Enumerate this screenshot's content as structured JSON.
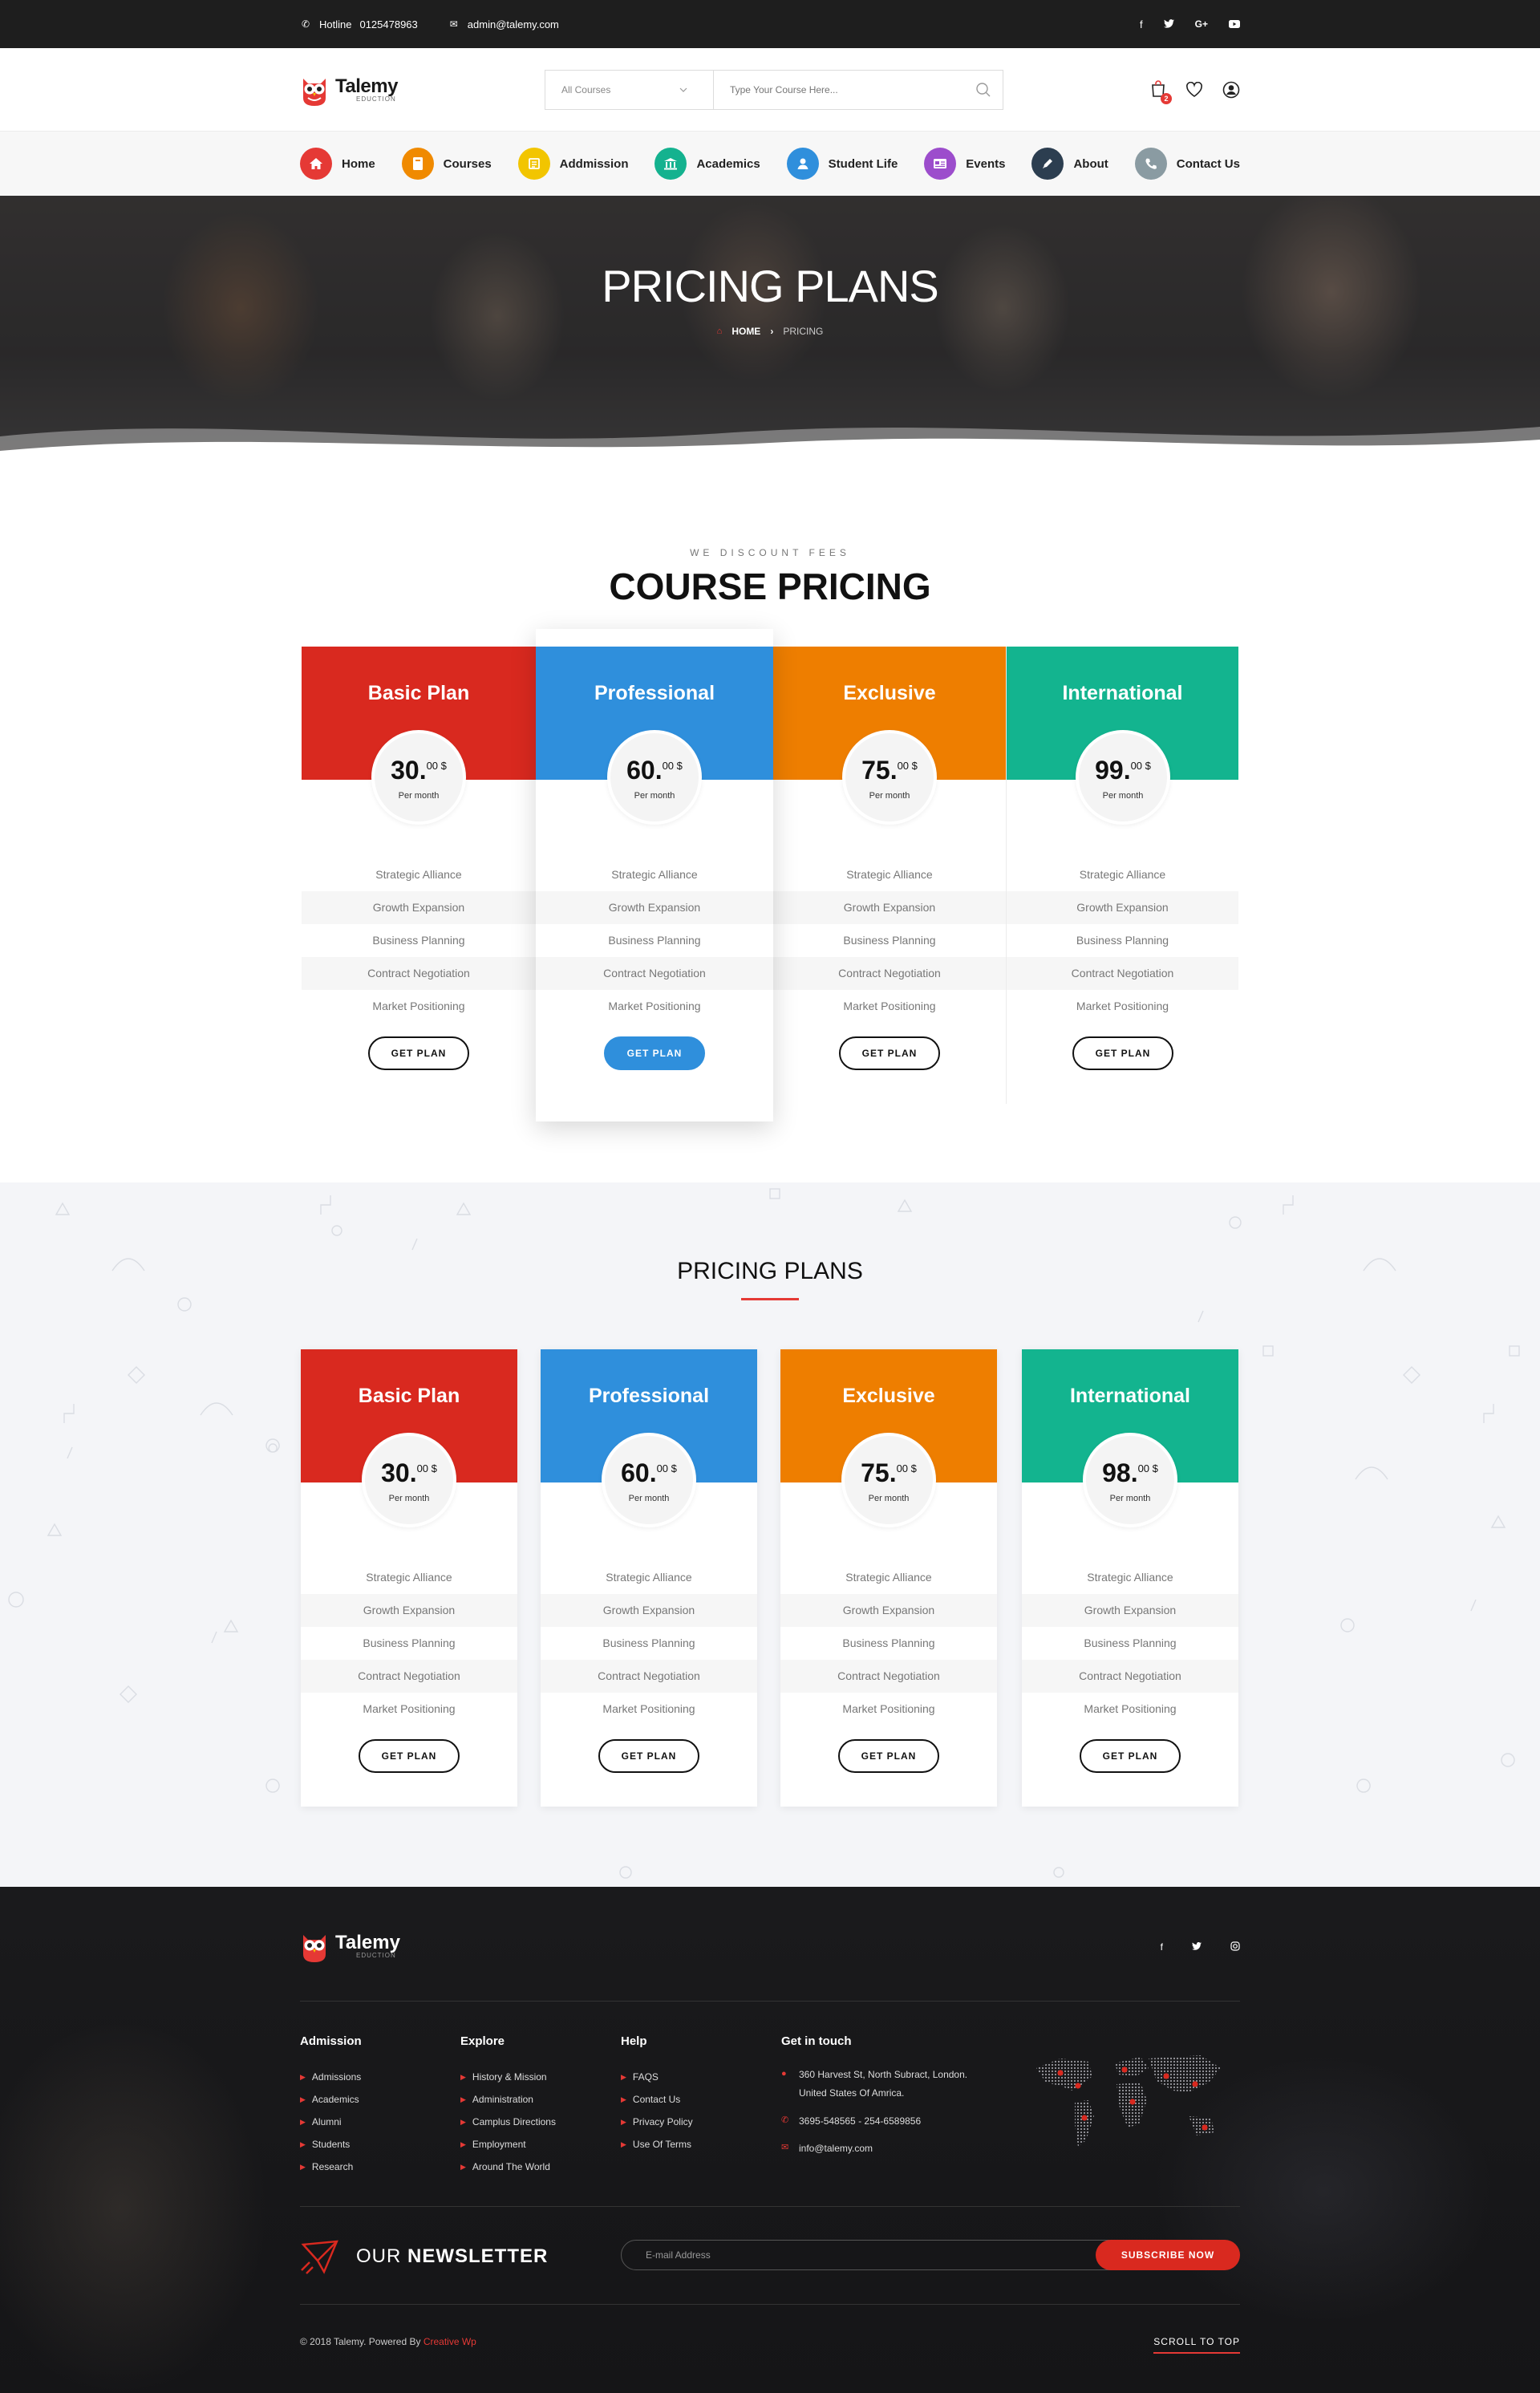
{
  "topbar": {
    "hotline_label": "Hotline",
    "hotline_number": "0125478963",
    "email": "admin@talemy.com",
    "socials": [
      "f",
      "t",
      "G+",
      "yt"
    ]
  },
  "header": {
    "brand": "Talemy",
    "tagline": "EDUCTION",
    "search_category": "All Courses",
    "search_placeholder": "Type Your Course Here...",
    "cart_count": "2"
  },
  "nav": [
    {
      "label": "Home",
      "icon": "home-icon",
      "color": "#e53935"
    },
    {
      "label": "Courses",
      "icon": "book-icon",
      "color": "#f08a00"
    },
    {
      "label": "Addmission",
      "icon": "document-icon",
      "color": "#f2c500"
    },
    {
      "label": "Academics",
      "icon": "bank-icon",
      "color": "#14b28f"
    },
    {
      "label": "Student Life",
      "icon": "user-icon",
      "color": "#2f8fdc"
    },
    {
      "label": "Events",
      "icon": "calendar-icon",
      "color": "#9c4dcc"
    },
    {
      "label": "About",
      "icon": "pen-icon",
      "color": "#2c3e50"
    },
    {
      "label": "Contact Us",
      "icon": "phone-icon",
      "color": "#8a9ba2"
    }
  ],
  "hero": {
    "title": "PRICING PLANS",
    "crumb_home": "HOME",
    "crumb_sep": "›",
    "crumb_current": "PRICING"
  },
  "section1": {
    "eyebrow": "WE DISCOUNT FEES",
    "title": "COURSE PRICING",
    "plans": [
      {
        "name": "Basic Plan",
        "price": "30.",
        "cents": "00 $",
        "period": "Per month",
        "color": "#d9291f",
        "button": "GET PLAN"
      },
      {
        "name": "Professional",
        "price": "60.",
        "cents": "00 $",
        "period": "Per month",
        "color": "#2f8fdc",
        "button": "GET PLAN"
      },
      {
        "name": "Exclusive",
        "price": "75.",
        "cents": "00 $",
        "period": "Per month",
        "color": "#ee7e00",
        "button": "GET PLAN"
      },
      {
        "name": "International",
        "price": "99.",
        "cents": "00 $",
        "period": "Per month",
        "color": "#13b48f",
        "button": "GET PLAN"
      }
    ],
    "features": [
      "Strategic Alliance",
      "Growth Expansion",
      "Business Planning",
      "Contract Negotiation",
      "Market Positioning"
    ]
  },
  "section2": {
    "title": "PRICING PLANS",
    "plans": [
      {
        "name": "Basic Plan",
        "price": "30.",
        "cents": "00 $",
        "period": "Per month",
        "color": "#d9291f",
        "button": "GET PLAN"
      },
      {
        "name": "Professional",
        "price": "60.",
        "cents": "00 $",
        "period": "Per month",
        "color": "#2f8fdc",
        "button": "GET PLAN"
      },
      {
        "name": "Exclusive",
        "price": "75.",
        "cents": "00 $",
        "period": "Per month",
        "color": "#ee7e00",
        "button": "GET PLAN"
      },
      {
        "name": "International",
        "price": "98.",
        "cents": "00 $",
        "period": "Per month",
        "color": "#13b48f",
        "button": "GET PLAN"
      }
    ],
    "features": [
      "Strategic Alliance",
      "Growth Expansion",
      "Business Planning",
      "Contract Negotiation",
      "Market Positioning"
    ]
  },
  "footer": {
    "brand": "Talemy",
    "tagline": "EDUCTION",
    "socials": [
      "f",
      "t",
      "ig"
    ],
    "columns": [
      {
        "title": "Admission",
        "items": [
          "Admissions",
          "Academics",
          "Alumni",
          "Students",
          "Research"
        ]
      },
      {
        "title": "Explore",
        "items": [
          "History & Mission",
          "Administration",
          "Camplus Directions",
          "Employment",
          "Around The World"
        ]
      },
      {
        "title": "Help",
        "items": [
          "FAQS",
          "Contact Us",
          "Privacy Policy",
          "Use Of Terms"
        ]
      }
    ],
    "contact": {
      "title": "Get in touch",
      "address_line1": "360 Harvest St, North Subract, London.",
      "address_line2": "United States Of Amrica.",
      "phone": "3695-548565  -  254-6589856",
      "email": "info@talemy.com"
    },
    "newsletter": {
      "title_light": "OUR",
      "title_bold": "NEWSLETTER",
      "placeholder": "E-mail Address",
      "button": "SUBSCRIBE NOW"
    },
    "copyright": "© 2018 Talemy.  Powered By",
    "copyright_link": "Creative Wp",
    "scroll_top": "SCROLL TO TOP"
  }
}
